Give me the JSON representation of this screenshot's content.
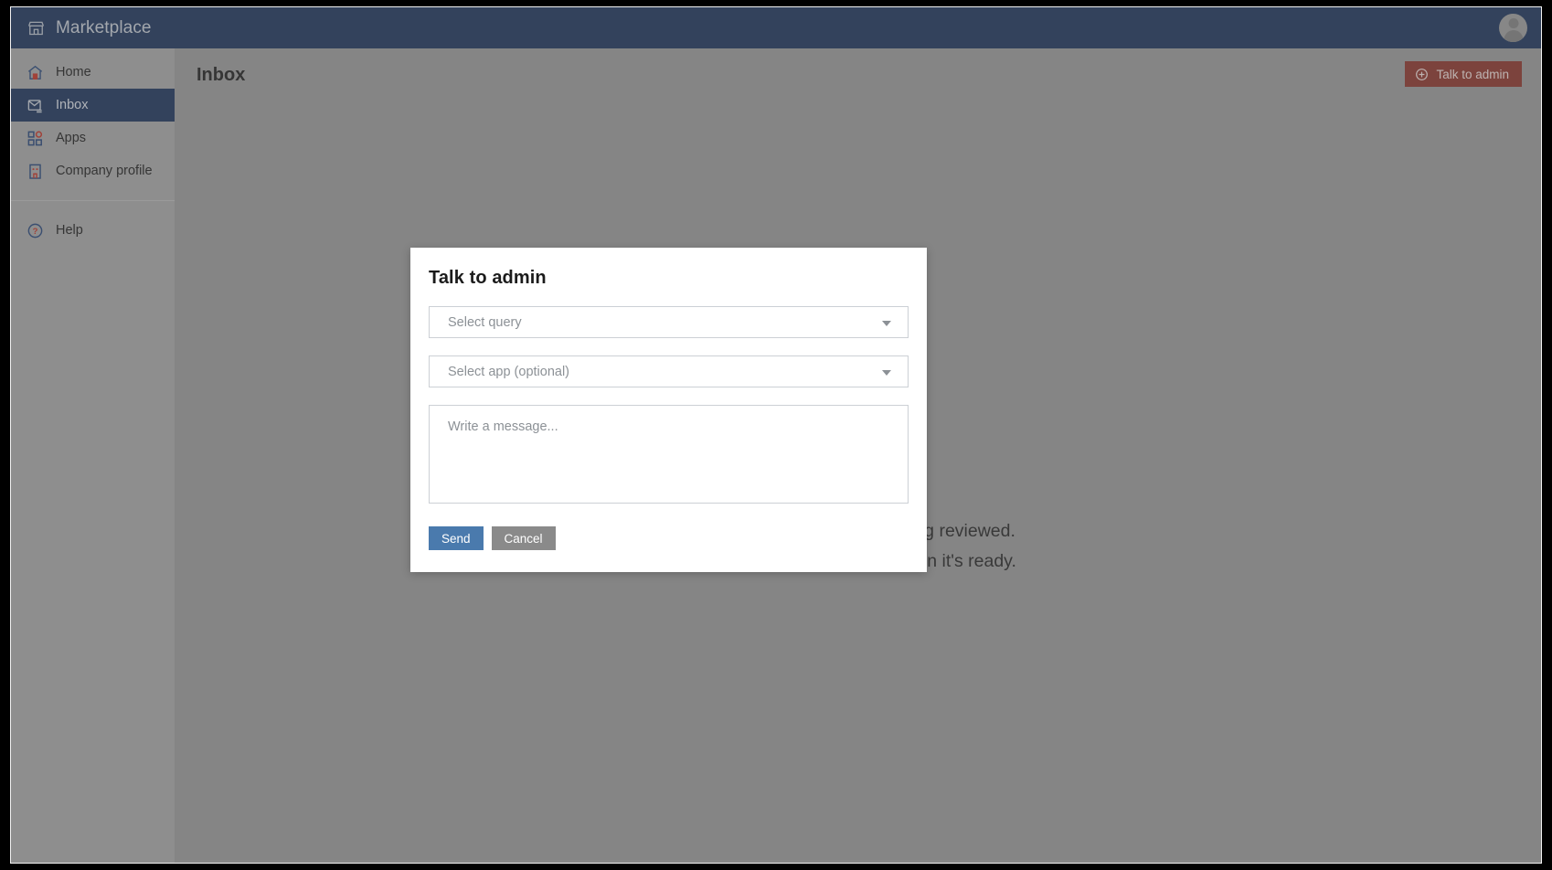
{
  "topbar": {
    "brand_icon": "storefront-icon",
    "brand_title": "Marketplace",
    "avatar_icon": "user-avatar-icon"
  },
  "sidebar": {
    "items": [
      {
        "label": "Home",
        "icon": "home-icon",
        "active": false
      },
      {
        "label": "Inbox",
        "icon": "inbox-icon",
        "active": true
      },
      {
        "label": "Apps",
        "icon": "apps-grid-icon",
        "active": false
      },
      {
        "label": "Company profile",
        "icon": "building-icon",
        "active": false
      }
    ],
    "footer_items": [
      {
        "label": "Help",
        "icon": "help-circle-icon",
        "active": false
      }
    ]
  },
  "page": {
    "title": "Inbox",
    "talk_to_admin_label": "Talk to admin",
    "talk_to_admin_icon": "plus-circle-icon",
    "empty_state_line1": "Your app submission is being reviewed.",
    "empty_state_line2": "We'll send you an email when it's ready."
  },
  "modal": {
    "title": "Talk to admin",
    "query_select": {
      "placeholder": "Select query",
      "value": "",
      "caret_icon": "chevron-down-icon"
    },
    "app_select": {
      "placeholder": "Select app (optional)",
      "value": "",
      "caret_icon": "chevron-down-icon"
    },
    "message": {
      "placeholder": "Write a message...",
      "value": ""
    },
    "send_label": "Send",
    "cancel_label": "Cancel"
  },
  "colors": {
    "topbar_bg": "#23395d",
    "sidebar_bg": "#a5a5a5",
    "active_nav_bg": "#23395d",
    "main_bg": "#999999",
    "talk_admin_bg": "#8b3a31",
    "send_btn_bg": "#4a7aad",
    "cancel_btn_bg": "#8a8a8a",
    "icon_accent": "#c0392b",
    "icon_primary": "#2d4a7a"
  }
}
